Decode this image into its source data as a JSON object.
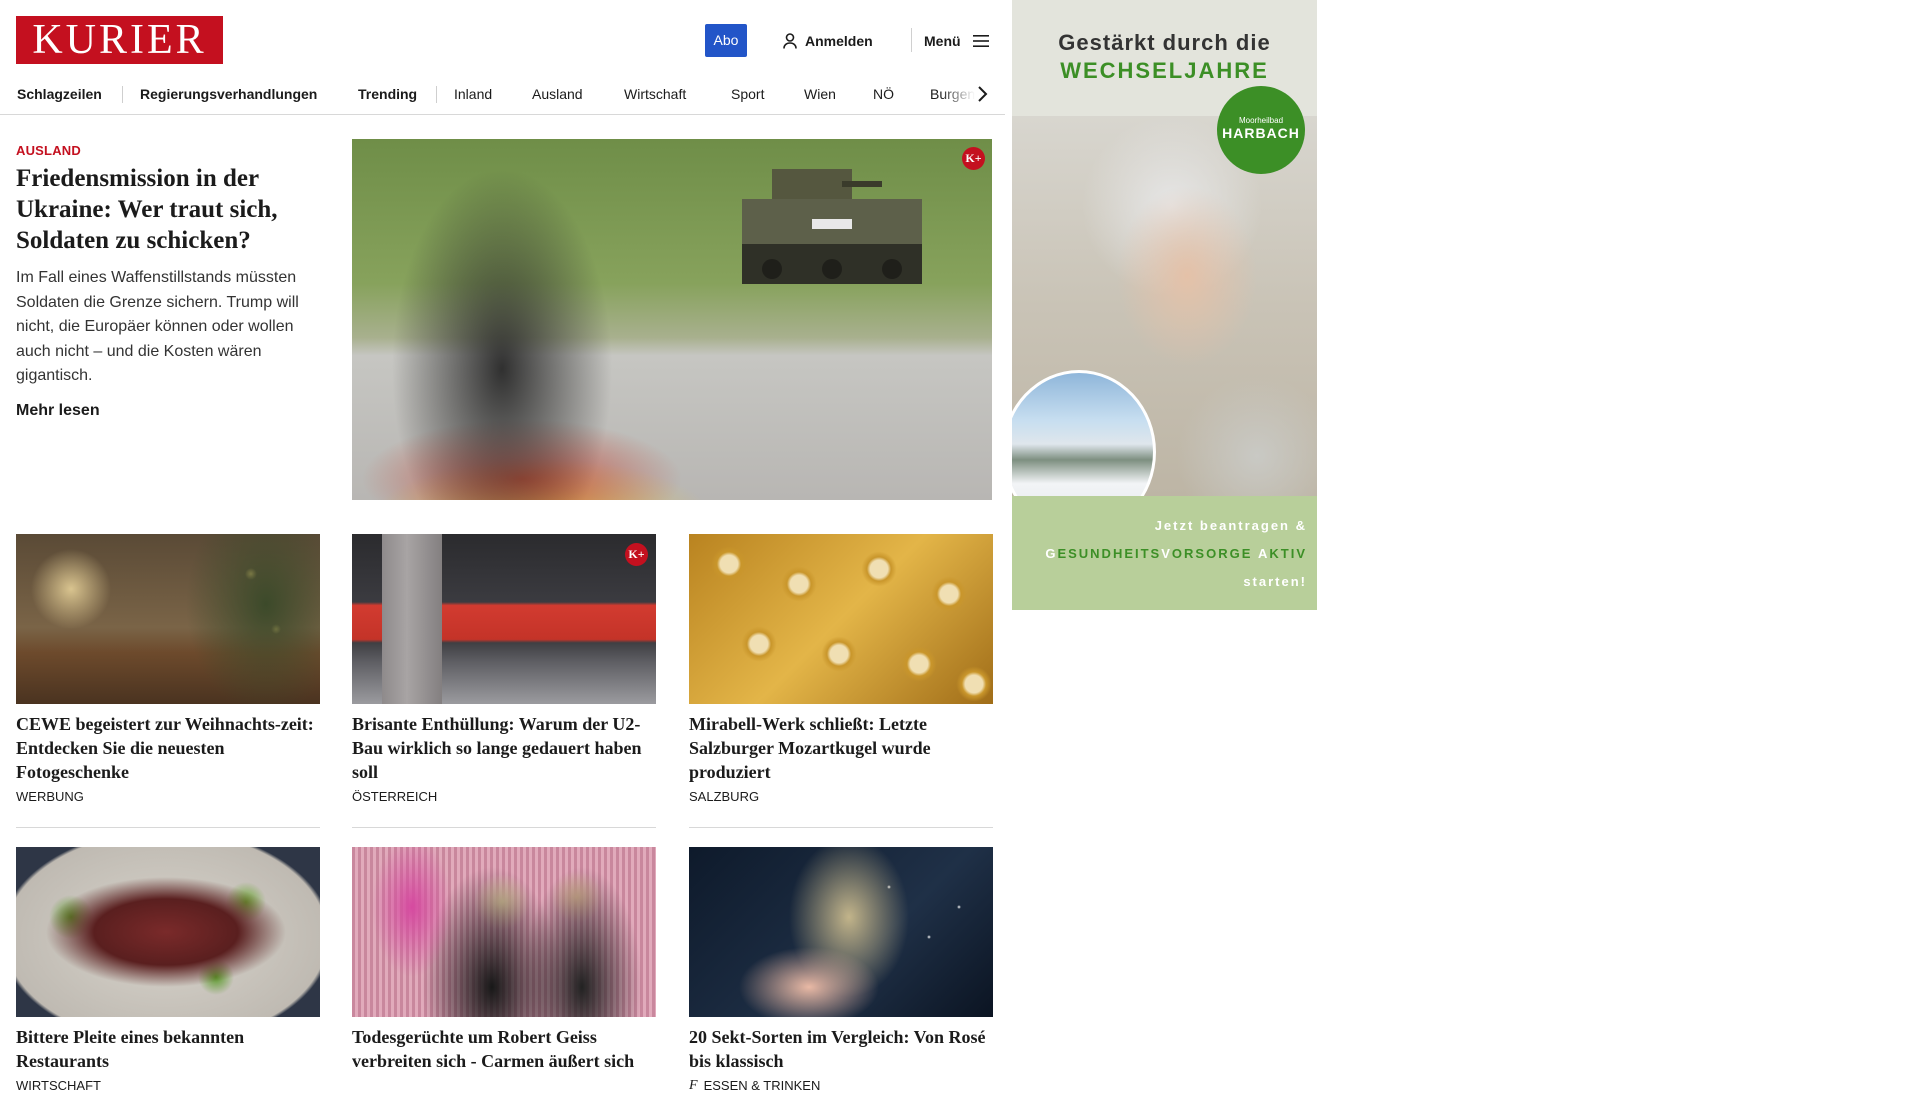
{
  "brand": {
    "logo_text": "KURIER",
    "accent": "#c4101f",
    "cta_color": "#2255c8"
  },
  "header": {
    "abo_label": "Abo",
    "login_label": "Anmelden",
    "login_icon": "user-icon",
    "menu_label": "Menü",
    "menu_icon": "hamburger-icon"
  },
  "nav": {
    "items": [
      {
        "label": "Schlagzeilen",
        "bold": true
      },
      {
        "label": "Regierungsverhandlungen",
        "bold": true
      },
      {
        "label": "Trending",
        "bold": true
      },
      {
        "label": "Inland",
        "bold": false
      },
      {
        "label": "Ausland",
        "bold": false
      },
      {
        "label": "Wirtschaft",
        "bold": false
      },
      {
        "label": "Sport",
        "bold": false
      },
      {
        "label": "Wien",
        "bold": false
      },
      {
        "label": "NÖ",
        "bold": false
      },
      {
        "label": "Burgenl",
        "bold": false
      }
    ],
    "next_icon": "chevron-right-icon"
  },
  "hero": {
    "kicker": "AUSLAND",
    "title": "Friedensmission in der Ukraine: Wer traut sich, Soldaten zu schicken?",
    "text": "Im Fall eines Waffenstillstands müssten Soldaten die Grenze sichern. Trump will nicht, die Europäer können oder wollen auch nicht – und die Kosten wären gigantisch.",
    "more_label": "Mehr lesen",
    "badge": "K+"
  },
  "cards": [
    {
      "title": "CEWE begeistert zur Weihnachts-zeit: Entdecken Sie die neuesten Fotogeschenke",
      "category": "WERBUNG",
      "premium": false
    },
    {
      "title": "Brisante Enthüllung: Warum der U2-Bau wirklich so lange gedauert haben soll",
      "category": "ÖSTERREICH",
      "premium": true,
      "badge": "K+"
    },
    {
      "title": "Mirabell-Werk schließt: Letzte Salzburger Mozartkugel wurde produziert",
      "category": "SALZBURG",
      "premium": false
    },
    {
      "title": "Bittere Pleite eines bekannten Restaurants",
      "category": "WIRTSCHAFT",
      "premium": false
    },
    {
      "title": "Todesgerüchte um Robert Geiss verbreiten sich - Carmen äußert sich",
      "category": "",
      "premium": false
    },
    {
      "title": "20 Sekt-Sorten im Vergleich: Von Rosé bis klassisch",
      "category": "ESSEN & TRINKEN",
      "premium": false,
      "category_icon": "script-f-icon"
    }
  ],
  "ad": {
    "line1": "Gestärkt durch die",
    "line2": "WECHSELJAHRE",
    "badge_small": "Moorheilbad",
    "badge_big": "HARBACH",
    "cta_line1": "Jetzt beantragen &",
    "cta_line2_parts": [
      "G",
      "ESUNDHEITS",
      "V",
      "ORSORGE ",
      "A",
      "KTIV"
    ],
    "cta_line3": "starten!"
  }
}
